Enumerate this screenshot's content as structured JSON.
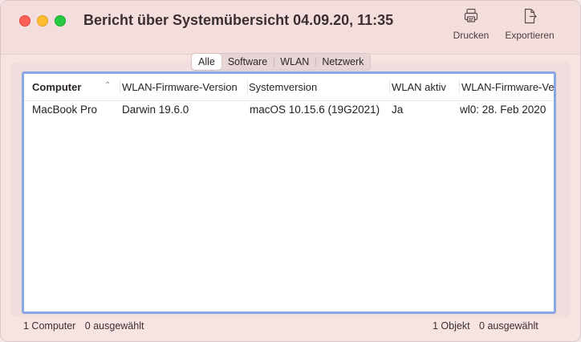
{
  "window": {
    "title": "Bericht über Systemübersicht 04.09.20, 11:35"
  },
  "toolbar": {
    "print_label": "Drucken",
    "print_icon": "printer-icon",
    "export_label": "Exportieren",
    "export_icon": "export-icon"
  },
  "segments": [
    {
      "label": "Alle",
      "selected": true
    },
    {
      "label": "Software",
      "selected": false
    },
    {
      "label": "WLAN",
      "selected": false
    },
    {
      "label": "Netzwerk",
      "selected": false
    }
  ],
  "table": {
    "columns": [
      "Computer",
      "WLAN-Firmware-Version",
      "Systemversion",
      "WLAN aktiv",
      "WLAN-Firmware-Ve"
    ],
    "sort_icon": "chevron-up-icon",
    "rows": [
      [
        "MacBook Pro",
        "Darwin 19.6.0",
        "macOS 10.15.6 (19G2021)",
        "Ja",
        "wl0: 28. Feb 2020"
      ]
    ]
  },
  "status": {
    "left_count": "1 Computer",
    "left_selected": "0 ausgewählt",
    "right_count": "1 Objekt",
    "right_selected": "0 ausgewählt"
  },
  "colors": {
    "close": "#fe5f57",
    "minimize": "#febc2e",
    "maximize": "#28c840",
    "focus_ring": "#8aa6e6"
  }
}
